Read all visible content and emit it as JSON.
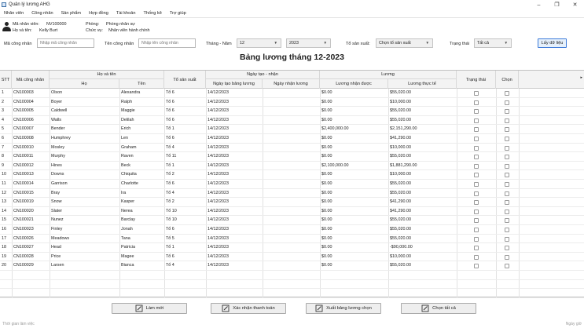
{
  "window": {
    "title": "Quản lý lương AHG",
    "minimize": "–",
    "maximize": "❐",
    "close": "✕"
  },
  "menu": [
    "Nhân viên",
    "Công nhân",
    "Sản phẩm",
    "Hợp đồng",
    "Tài khoản",
    "Thống kê",
    "Trợ giúp"
  ],
  "user": {
    "id_label": "Mã nhân viên:",
    "id_value": "NV100000",
    "name_label": "Họ và tên:",
    "name_value": "Kelly Burt",
    "dept_label": "Phòng:",
    "dept_value": "Phòng nhân sự",
    "role_label": "Chức vụ:",
    "role_value": "Nhân viên hành chính"
  },
  "filters": {
    "code_label": "Mã công nhân",
    "code_placeholder": "Nhập mã công nhân",
    "name_label": "Tên công nhân",
    "name_placeholder": "Nhập tên công nhân",
    "month_year_label": "Tháng - Năm",
    "month_value": "12",
    "year_value": "2023",
    "team_label": "Tổ sản xuất:",
    "team_value": "Chọn tổ sản xuất",
    "status_label": "Trạng thái",
    "status_value": "Tất cả",
    "fetch_button": "Lấy dữ liệu"
  },
  "report_title": "Bảng lương tháng 12-2023",
  "table": {
    "headers": {
      "stt": "STT",
      "code": "Mã công nhân",
      "fullname": "Họ và tên",
      "last": "Họ",
      "first": "Tên",
      "team": "Tổ sản xuất",
      "dates": "Ngày tạo - nhận",
      "created": "Ngày tạo bảng lương",
      "received": "Ngày nhận lương",
      "salary": "Lương",
      "received_salary": "Lương nhận được",
      "actual_salary": "Lương thực tế",
      "status": "Trạng thái",
      "select": "Chọn",
      "corner": "▸"
    },
    "rows": [
      {
        "stt": "1",
        "code": "CN100003",
        "last": "Olson",
        "first": "Alexandra",
        "team": "Tổ 6",
        "created": "14/12/2023",
        "received": "",
        "got": "$0.00",
        "actual": "$55,020.00"
      },
      {
        "stt": "2",
        "code": "CN100004",
        "last": "Boyer",
        "first": "Ralph",
        "team": "Tổ 6",
        "created": "14/12/2023",
        "received": "",
        "got": "$0.00",
        "actual": "$10,000.00"
      },
      {
        "stt": "3",
        "code": "CN100005",
        "last": "Caldwell",
        "first": "Maggie",
        "team": "Tổ 6",
        "created": "14/12/2023",
        "received": "",
        "got": "$0.00",
        "actual": "$55,020.00"
      },
      {
        "stt": "4",
        "code": "CN100006",
        "last": "Walls",
        "first": "Delilah",
        "team": "Tổ 6",
        "created": "14/12/2023",
        "received": "",
        "got": "$0.00",
        "actual": "$55,020.00"
      },
      {
        "stt": "5",
        "code": "CN100007",
        "last": "Bender",
        "first": "Erich",
        "team": "Tổ 1",
        "created": "14/12/2023",
        "received": "",
        "got": "$2,400,000.00",
        "actual": "$2,151,290.00"
      },
      {
        "stt": "6",
        "code": "CN100008",
        "last": "Humphrey",
        "first": "Len",
        "team": "Tổ 6",
        "created": "14/12/2023",
        "received": "",
        "got": "$0.00",
        "actual": "$41,290.00"
      },
      {
        "stt": "7",
        "code": "CN100010",
        "last": "Mosley",
        "first": "Graham",
        "team": "Tổ 4",
        "created": "14/12/2023",
        "received": "",
        "got": "$0.00",
        "actual": "$10,000.00"
      },
      {
        "stt": "8",
        "code": "CN100011",
        "last": "Murphy",
        "first": "Raven",
        "team": "Tổ 11",
        "created": "14/12/2023",
        "received": "",
        "got": "$0.00",
        "actual": "$55,020.00"
      },
      {
        "stt": "9",
        "code": "CN100012",
        "last": "Hines",
        "first": "Beck",
        "team": "Tổ 1",
        "created": "14/12/2023",
        "received": "",
        "got": "$2,100,000.00",
        "actual": "$1,881,290.00"
      },
      {
        "stt": "10",
        "code": "CN100013",
        "last": "Downs",
        "first": "Chiquita",
        "team": "Tổ 2",
        "created": "14/12/2023",
        "received": "",
        "got": "$0.00",
        "actual": "$10,000.00"
      },
      {
        "stt": "11",
        "code": "CN100014",
        "last": "Garrison",
        "first": "Charlotte",
        "team": "Tổ 6",
        "created": "14/12/2023",
        "received": "",
        "got": "$0.00",
        "actual": "$55,020.00"
      },
      {
        "stt": "12",
        "code": "CN100015",
        "last": "Bray",
        "first": "Ira",
        "team": "Tổ 4",
        "created": "14/12/2023",
        "received": "",
        "got": "$0.00",
        "actual": "$55,020.00"
      },
      {
        "stt": "13",
        "code": "CN100019",
        "last": "Snow",
        "first": "Kasper",
        "team": "Tổ 2",
        "created": "14/12/2023",
        "received": "",
        "got": "$0.00",
        "actual": "$41,290.00"
      },
      {
        "stt": "14",
        "code": "CN100020",
        "last": "Slater",
        "first": "Nerea",
        "team": "Tổ 10",
        "created": "14/12/2023",
        "received": "",
        "got": "$0.00",
        "actual": "$41,290.00"
      },
      {
        "stt": "15",
        "code": "CN100021",
        "last": "Nunez",
        "first": "Barclay",
        "team": "Tổ 10",
        "created": "14/12/2023",
        "received": "",
        "got": "$0.00",
        "actual": "$55,020.00"
      },
      {
        "stt": "16",
        "code": "CN100023",
        "last": "Finley",
        "first": "Jonah",
        "team": "Tổ 6",
        "created": "14/12/2023",
        "received": "",
        "got": "$0.00",
        "actual": "$55,020.00"
      },
      {
        "stt": "17",
        "code": "CN100026",
        "last": "Meadows",
        "first": "Tana",
        "team": "Tổ 5",
        "created": "14/12/2023",
        "received": "",
        "got": "$0.00",
        "actual": "$55,020.00"
      },
      {
        "stt": "18",
        "code": "CN100027",
        "last": "Head",
        "first": "Patricia",
        "team": "Tổ 1",
        "created": "14/12/2023",
        "received": "",
        "got": "$0.00",
        "actual": "-$90,000.00"
      },
      {
        "stt": "19",
        "code": "CN100028",
        "last": "Price",
        "first": "Magee",
        "team": "Tổ 6",
        "created": "14/12/2023",
        "received": "",
        "got": "$0.00",
        "actual": "$10,000.00"
      },
      {
        "stt": "20",
        "code": "CN100029",
        "last": "Larsen",
        "first": "Bianca",
        "team": "Tổ 4",
        "created": "14/12/2023",
        "received": "",
        "got": "$0.00",
        "actual": "$55,020.00"
      }
    ]
  },
  "actions": {
    "refresh": "Làm mới",
    "confirm_payment": "Xác nhận thanh toán",
    "export_selected": "Xuất bảng lương chọn",
    "select_all": "Chọn tất cả"
  },
  "status": {
    "left": "Thời gian làm việc",
    "right": "Ngày giờ"
  }
}
